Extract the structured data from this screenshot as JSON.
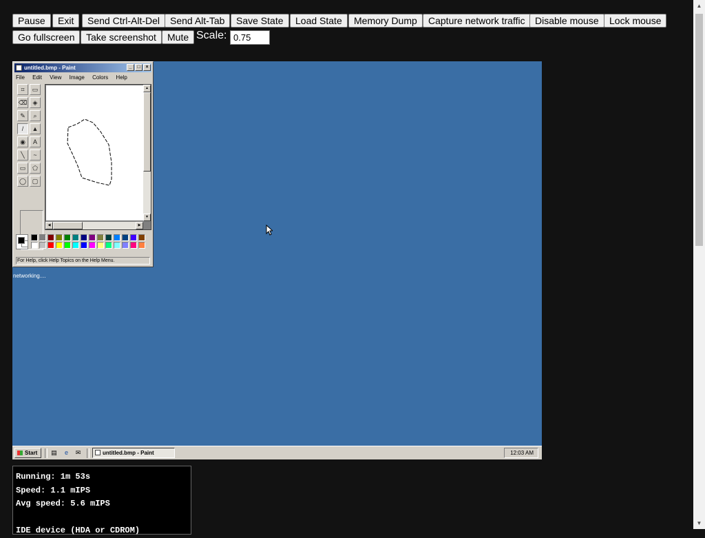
{
  "controls": {
    "buttons": [
      "Pause",
      "Exit",
      "Send Ctrl-Alt-Del",
      "Send Alt-Tab",
      "Save State",
      "Load State",
      "Memory Dump",
      "Capture network traffic",
      "Disable mouse",
      "Lock mouse",
      "Go fullscreen",
      "Take screenshot",
      "Mute"
    ],
    "scale_label": "Scale:",
    "scale_value": "0.75"
  },
  "vm": {
    "paint": {
      "title": "untitled.bmp - Paint",
      "menu": [
        "File",
        "Edit",
        "View",
        "Image",
        "Colors",
        "Help"
      ],
      "status": "For Help, click Help Topics on the Help Menu.",
      "tools": [
        "free-select",
        "select",
        "eraser",
        "fill",
        "pick-color",
        "magnifier",
        "pencil",
        "brush",
        "airbrush",
        "text",
        "line",
        "curve",
        "rectangle",
        "polygon",
        "ellipse",
        "rounded-rectangle"
      ],
      "tool_glyphs": [
        "⌗",
        "▭",
        "⌫",
        "◈",
        "✎",
        "⌕",
        "/",
        "▲",
        "◉",
        "A",
        "╲",
        "~",
        "▭",
        "⬠",
        "◯",
        "▢"
      ],
      "active_tool": "pencil",
      "palette": [
        "#000000",
        "#808080",
        "#800000",
        "#808000",
        "#008000",
        "#008080",
        "#000080",
        "#800080",
        "#808040",
        "#004040",
        "#0080ff",
        "#004080",
        "#4000ff",
        "#804000",
        "#ffffff",
        "#c0c0c0",
        "#ff0000",
        "#ffff00",
        "#00ff00",
        "#00ffff",
        "#0000ff",
        "#ff00ff",
        "#ffff80",
        "#00ff80",
        "#80ffff",
        "#8080ff",
        "#ff0080",
        "#ff8040"
      ]
    },
    "networking_text": "networking....",
    "taskbar": {
      "start_label": "Start",
      "task_label": "untitled.bmp - Paint",
      "clock": "12:03 AM"
    }
  },
  "info": {
    "running": "Running: 1m 53s",
    "speed": "Speed: 1.1 mIPS",
    "avg_speed": "Avg speed: 5.6 mIPS",
    "blank": "",
    "ide": "IDE device (HDA or CDROM)"
  }
}
